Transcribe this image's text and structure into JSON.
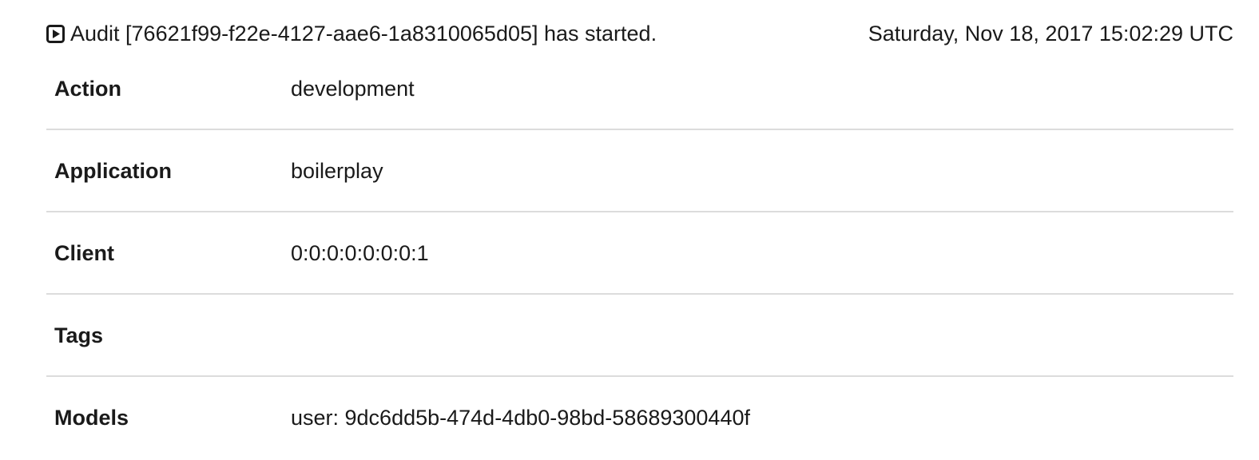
{
  "header": {
    "icon": "play-square-icon",
    "message": "Audit [76621f99-f22e-4127-aae6-1a8310065d05] has started.",
    "timestamp": "Saturday, Nov 18, 2017 15:02:29 UTC"
  },
  "details": [
    {
      "label": "Action",
      "value": "development"
    },
    {
      "label": "Application",
      "value": "boilerplay"
    },
    {
      "label": "Client",
      "value": "0:0:0:0:0:0:0:1"
    },
    {
      "label": "Tags",
      "value": ""
    },
    {
      "label": "Models",
      "value": "user: 9dc6dd5b-474d-4db0-98bd-58689300440f"
    }
  ]
}
